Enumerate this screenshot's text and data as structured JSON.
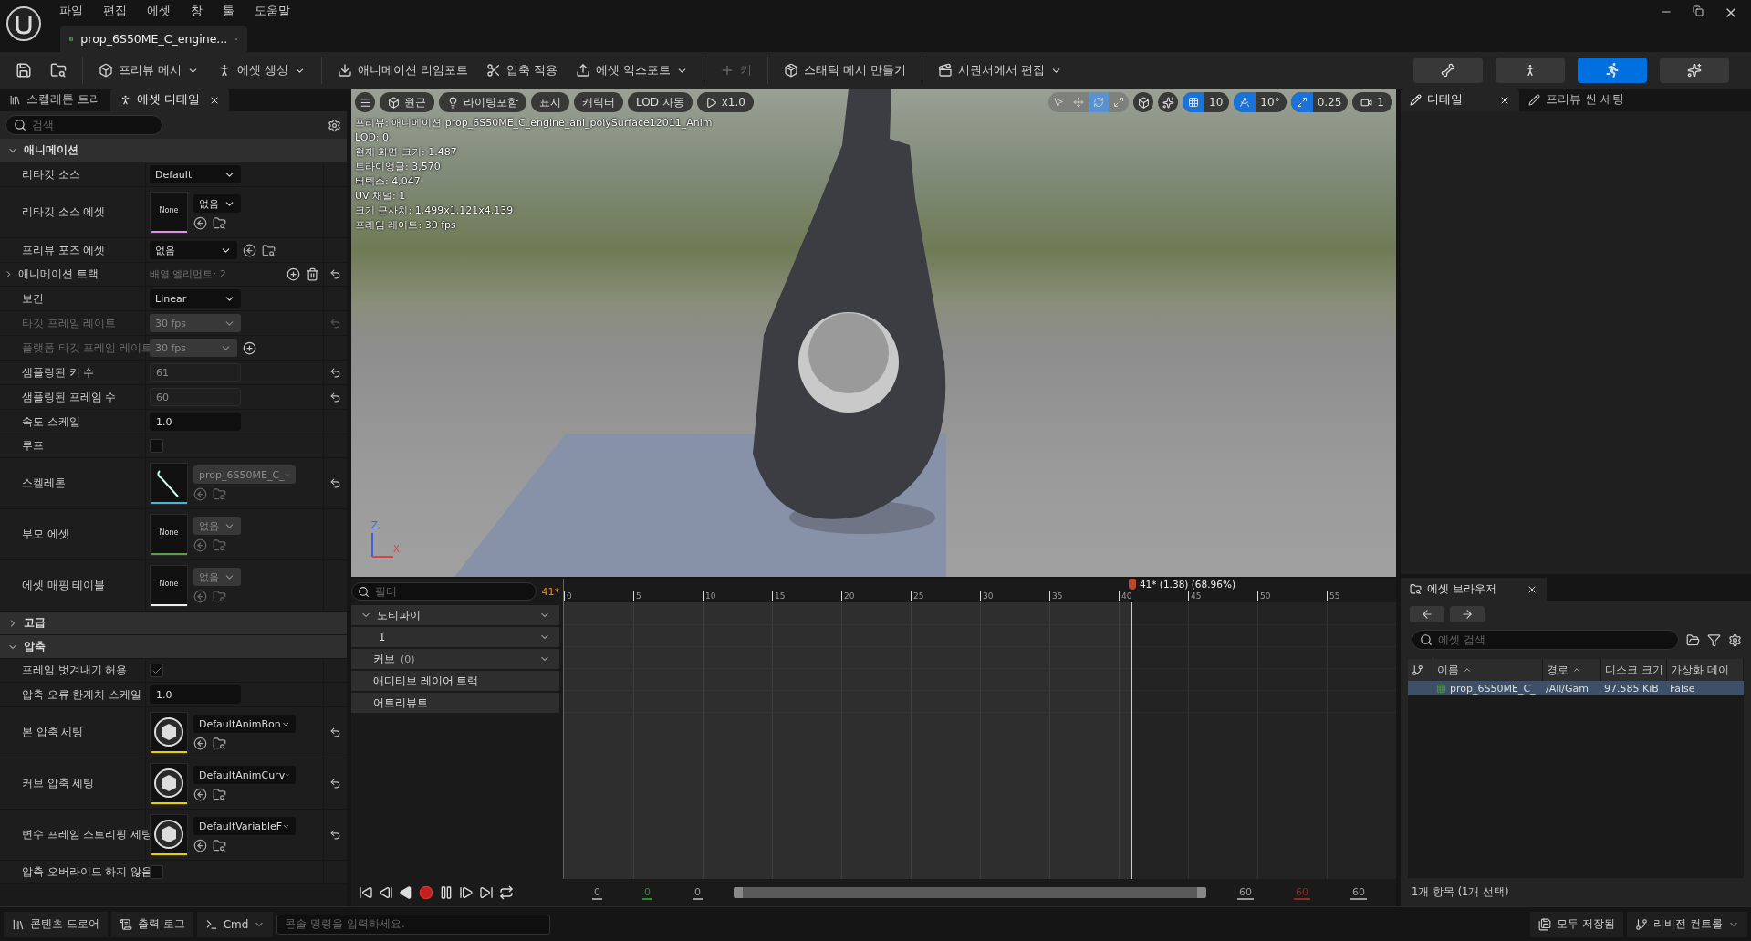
{
  "menu": [
    "파일",
    "편집",
    "에셋",
    "창",
    "툴",
    "도움말"
  ],
  "document_tab": {
    "label": "prop_6S50ME_C_engine..."
  },
  "toolbar": [
    {
      "label": "프리뷰 메시",
      "dropdown": true,
      "disabled": false
    },
    {
      "label": "에셋 생성",
      "dropdown": true,
      "disabled": false
    },
    {
      "label": "애니메이션 리임포트",
      "dropdown": false,
      "disabled": false
    },
    {
      "label": "압축 적용",
      "dropdown": false,
      "disabled": false
    },
    {
      "label": "에셋 익스포트",
      "dropdown": true,
      "disabled": false
    },
    {
      "label": "키",
      "dropdown": false,
      "disabled": true
    },
    {
      "label": "스태틱 메시 만들기",
      "dropdown": false,
      "disabled": false
    },
    {
      "label": "시퀀서에서 편집",
      "dropdown": true,
      "disabled": false
    }
  ],
  "mode_buttons": [
    {
      "selected": false
    },
    {
      "selected": false
    },
    {
      "selected": true
    },
    {
      "selected": false
    }
  ],
  "left_panel": {
    "tabs": [
      {
        "label": "스켈레톤 트리",
        "selected": false
      },
      {
        "label": "에셋 디테일",
        "selected": true
      }
    ],
    "search": {
      "placeholder": "검색"
    },
    "sections": [
      {
        "title": "애니메이션",
        "expanded": true,
        "rows": [
          {
            "kind": "dropdown",
            "label": "리타깃 소스",
            "value": "Default",
            "disabled": false,
            "dimmed": false,
            "reset": false
          },
          {
            "kind": "asset",
            "label": "리타깃 소스 에셋",
            "preview": {
              "kind": "text",
              "label": "None"
            },
            "color": "#e58ee5",
            "value": "없음",
            "disabled": false,
            "dimmed": false,
            "reset": false
          },
          {
            "kind": "inline_asset",
            "label": "프리뷰 포즈 에셋",
            "value": "없음",
            "disabled": false,
            "dimmed": false,
            "reset": false
          },
          {
            "kind": "array",
            "label": "애니메이션 트랙",
            "value": "배열 엘리먼트: 2",
            "expanded": false,
            "disabled": false,
            "dimmed": false,
            "reset": true
          },
          {
            "kind": "dropdown",
            "label": "보간",
            "value": "Linear",
            "disabled": false,
            "dimmed": false,
            "reset": false
          },
          {
            "kind": "dropdown",
            "label": "타깃 프레임 레이트",
            "value": "30 fps",
            "disabled": true,
            "dimmed": true,
            "reset": true
          },
          {
            "kind": "dropdown_add",
            "label": "플랫폼 타깃 프레임 레이트",
            "value": "30 fps",
            "disabled": true,
            "dimmed": true,
            "reset": false
          },
          {
            "kind": "field",
            "label": "샘플링된 키 수",
            "value": "61",
            "disabled": true,
            "dimmed": false,
            "reset": true
          },
          {
            "kind": "field",
            "label": "샘플링된 프레임 수",
            "value": "60",
            "disabled": true,
            "dimmed": false,
            "reset": true
          },
          {
            "kind": "field",
            "label": "속도 스케일",
            "value": "1.0",
            "disabled": false,
            "dimmed": false,
            "reset": false
          },
          {
            "kind": "checkbox",
            "label": "루프",
            "checked": false,
            "disabled": false,
            "dimmed": false,
            "reset": false
          },
          {
            "kind": "asset",
            "label": "스켈레톤",
            "preview": {
              "kind": "skeleton"
            },
            "color": "#4fb3d9",
            "value": "prop_6S50ME_C_",
            "disabled": true,
            "dimmed": false,
            "reset": true
          },
          {
            "kind": "asset",
            "label": "부모 에셋",
            "preview": {
              "kind": "text",
              "label": "None"
            },
            "color": "#5f9a4f",
            "value": "없음",
            "disabled": true,
            "dimmed": false,
            "reset": false
          },
          {
            "kind": "asset",
            "label": "에셋 매핑 테이블",
            "preview": {
              "kind": "text",
              "label": "None"
            },
            "color": "#eeeeee",
            "value": "없음",
            "disabled": true,
            "dimmed": false,
            "reset": false
          }
        ]
      },
      {
        "title": "고급",
        "expanded": false
      },
      {
        "title": "압축",
        "expanded": true,
        "rows": [
          {
            "kind": "checkbox",
            "label": "프레임 벗겨내기 허용",
            "checked": true,
            "disabled": false,
            "dimmed": false,
            "reset": false
          },
          {
            "kind": "field",
            "label": "압축 오류 한계치 스케일",
            "value": "1.0",
            "disabled": false,
            "dimmed": false,
            "reset": false
          },
          {
            "kind": "asset",
            "label": "본 압축 세팅",
            "preview": {
              "kind": "settings"
            },
            "color": "#e8d200",
            "value": "DefaultAnimBon",
            "disabled": false,
            "dimmed": false,
            "reset": true
          },
          {
            "kind": "asset",
            "label": "커브 압축 세팅",
            "preview": {
              "kind": "settings"
            },
            "color": "#e8d200",
            "value": "DefaultAnimCurv",
            "disabled": false,
            "dimmed": false,
            "reset": true
          },
          {
            "kind": "asset",
            "label": "변수 프레임 스트리핑 세팅",
            "preview": {
              "kind": "settings"
            },
            "color": "#e8d200",
            "value": "DefaultVariableF",
            "disabled": false,
            "dimmed": false,
            "reset": true
          },
          {
            "kind": "checkbox",
            "label": "압축 오버라이드 하지 않음",
            "checked": false,
            "disabled": false,
            "dimmed": false,
            "reset": false
          }
        ]
      }
    ]
  },
  "viewport": {
    "buttons": [
      {
        "label": "원근"
      },
      {
        "label": "라이팅포함"
      },
      {
        "label": "표시"
      },
      {
        "label": "캐릭터"
      },
      {
        "label": "LOD 자동"
      },
      {
        "label": "x1.0"
      }
    ],
    "transform_tools": [
      {
        "selected": false
      },
      {
        "selected": false
      },
      {
        "selected": true
      },
      {
        "selected": false
      }
    ],
    "snaps": [
      {
        "value": "10",
        "on": true
      },
      {
        "value": "10°",
        "on": true
      },
      {
        "value": "0.25",
        "on": true
      }
    ],
    "camera_speed": "1",
    "stats": [
      "프리뷰: 애니메이션 prop_6S50ME_C_engine_ani_polySurface12011_Anim",
      "LOD: 0",
      "현재 화면 크기: 1.487",
      "트라이앵글: 3,570",
      "버텍스: 4,047",
      "UV 채널: 1",
      "크기 근사치: 1,499x1,121x4,139",
      "프레임 레이트: 30 fps"
    ],
    "axis": [
      "Z",
      "X"
    ]
  },
  "timeline": {
    "filter": {
      "placeholder": "필터"
    },
    "current_frame": "41*",
    "tracks": [
      {
        "label": "노티파이",
        "kind": "header",
        "menu": true
      },
      {
        "label": "1",
        "kind": "child",
        "menu": true
      },
      {
        "label": "커브",
        "count": "(0)",
        "kind": "header",
        "menu": true
      },
      {
        "label": "애디티브 레이어 트랙",
        "kind": "header",
        "menu": false
      },
      {
        "label": "어트리뷰트",
        "kind": "header",
        "menu": false
      }
    ],
    "ticks": [
      "0",
      "5",
      "10",
      "15",
      "20",
      "25",
      "30",
      "35",
      "40",
      "45",
      "50",
      "55"
    ],
    "playhead": {
      "label": "41* (1.38) (68.96%)",
      "level": 0.683
    },
    "range_start": [
      {
        "value": "0",
        "color": "#9a9a9a"
      },
      {
        "value": "0",
        "color": "#2f8a2f"
      },
      {
        "value": "0",
        "color": "#9a9a9a"
      }
    ],
    "range_end": [
      {
        "value": "60",
        "color": "#9a9a9a"
      },
      {
        "value": "60",
        "color": "#8a2a2a"
      },
      {
        "value": "60",
        "color": "#9a9a9a"
      }
    ]
  },
  "right_panel": {
    "tabs": [
      {
        "label": "디테일",
        "selected": true
      },
      {
        "label": "프리뷰 씬 세팅",
        "selected": false
      }
    ]
  },
  "asset_browser": {
    "tab": "에셋 브라우저",
    "search": {
      "placeholder": "에셋 검색"
    },
    "columns": [
      "이름",
      "경로",
      "디스크 크기",
      "가상화 데이"
    ],
    "rows": [
      {
        "cells": [
          "prop_6S50ME_C_",
          "/All/Gam",
          "97.585 KiB",
          "False"
        ],
        "selected": true
      }
    ],
    "footer": "1개 항목 (1개 선택)"
  },
  "status_bar": {
    "left": [
      "콘텐츠 드로어",
      "출력 로그"
    ],
    "cmd": "Cmd",
    "console": {
      "placeholder": "콘솔 명령을 입력하세요."
    },
    "right": [
      "모두 저장됨",
      "리비전 컨트롤"
    ]
  }
}
